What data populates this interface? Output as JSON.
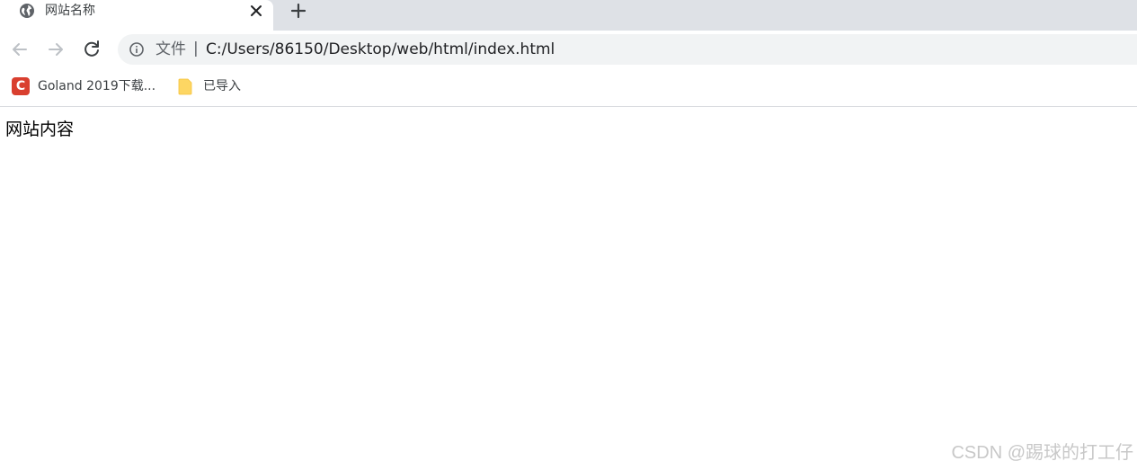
{
  "tab": {
    "title": "网站名称",
    "favicon": "globe-icon",
    "close_icon": "close-icon"
  },
  "new_tab_icon": "plus-icon",
  "toolbar": {
    "back_icon": "arrow-left-icon",
    "forward_icon": "arrow-right-icon",
    "reload_icon": "reload-icon",
    "address": {
      "info_icon": "info-icon",
      "scheme_label": "文件",
      "separator": "|",
      "url": "C:/Users/86150/Desktop/web/html/index.html"
    }
  },
  "bookmarks": {
    "items": [
      {
        "label": "Goland 2019下载...",
        "icon": "c-logo-icon",
        "icon_letter": "C",
        "icon_color": "#d93f2f"
      },
      {
        "label": "已导入",
        "icon": "folder-icon",
        "icon_color": "#fdd663"
      }
    ]
  },
  "page": {
    "body_text": "网站内容"
  },
  "watermark": "CSDN @踢球的打工仔",
  "colors": {
    "tabstrip_bg": "#dee1e6",
    "omnibox_bg": "#f1f3f4",
    "text": "#202124"
  }
}
